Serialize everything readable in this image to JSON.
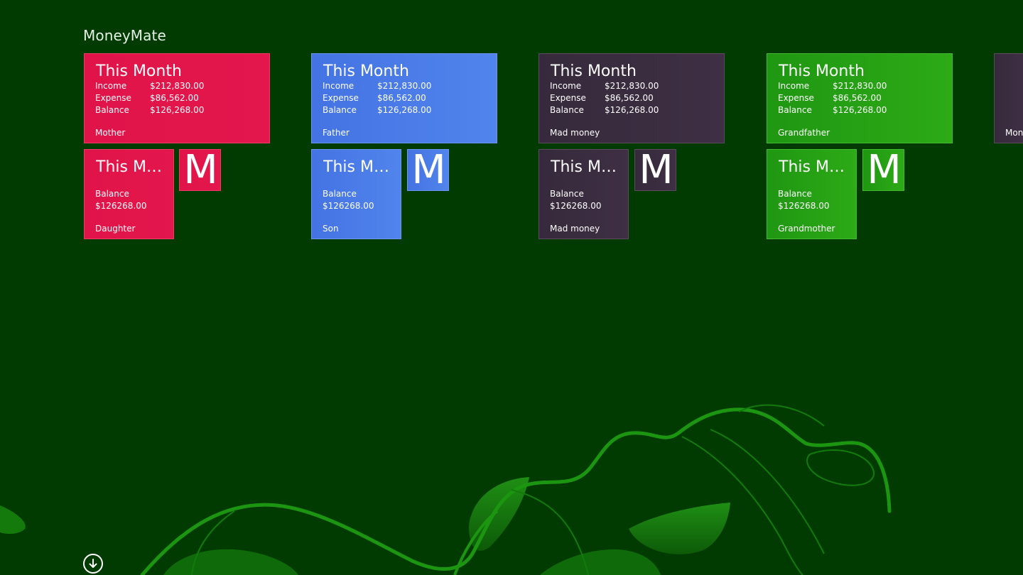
{
  "app": {
    "group_title": "MoneyMate"
  },
  "labels": {
    "this_month": "This Month",
    "this_month_short": "This Mo...",
    "income": "Income",
    "expense": "Expense",
    "balance": "Balance"
  },
  "tiles": [
    {
      "name": "Mother",
      "income": "$212,830.00",
      "expense": "$86,562.00",
      "balance": "$126,268.00",
      "color": "#e3174c"
    },
    {
      "name": "Father",
      "income": "$212,830.00",
      "expense": "$86,562.00",
      "balance": "$126,268.00",
      "color": "#4d7fea"
    },
    {
      "name": "Mad money",
      "income": "$212,830.00",
      "expense": "$86,562.00",
      "balance": "$126,268.00",
      "color": "#3b2d40"
    },
    {
      "name": "Grandfather",
      "income": "$212,830.00",
      "expense": "$86,562.00",
      "balance": "$126,268.00",
      "color": "#27a314"
    },
    {
      "name": "Mon"
    }
  ],
  "medium_tiles": [
    {
      "name": "Daughter",
      "balance": "$126268.00",
      "color": "#e3174c"
    },
    {
      "name": "Son",
      "balance": "$126268.00",
      "color": "#4d7fea"
    },
    {
      "name": "Mad money",
      "balance": "$126268.00",
      "color": "#3b2d40"
    },
    {
      "name": "Grandmother",
      "balance": "$126268.00",
      "color": "#27a314"
    }
  ],
  "small_tiles": [
    {
      "letter": "M"
    },
    {
      "letter": "M"
    },
    {
      "letter": "M"
    },
    {
      "letter": "M"
    }
  ],
  "icons": {
    "scroll": "arrow-down-circle-icon"
  },
  "colors": {
    "background": "#013b01",
    "swirl": "#1a8f10"
  }
}
